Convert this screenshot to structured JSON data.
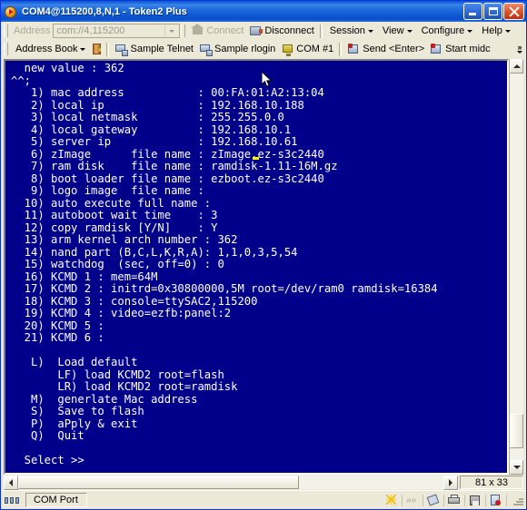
{
  "window": {
    "title": "COM4@115200,8,N,1 - Token2 Plus",
    "icon": "app-globe-icon",
    "buttons": {
      "minimize": "Minimize",
      "maximize": "Maximize",
      "close": "Close"
    }
  },
  "toolbar_top": {
    "address_label": "Address",
    "address_value": "com://4,115200",
    "connect_label": "Connect",
    "disconnect_label": "Disconnect",
    "menus": [
      "Session",
      "View",
      "Configure",
      "Help"
    ]
  },
  "toolbar_bottom": {
    "address_book_label": "Address Book",
    "items": [
      "Sample Telnet",
      "Sample rlogin",
      "COM #1",
      "Send <Enter>",
      "Start midc"
    ],
    "overflow": "»"
  },
  "terminal": {
    "background": "#00008b",
    "foreground": "#ffffff",
    "cursor_color": "#ffff00",
    "lines": [
      "  new value : 362",
      "^^;",
      "   1) mac address           : 00:FA:01:A2:13:04",
      "   2) local ip              : 192.168.10.188",
      "   3) local netmask         : 255.255.0.0",
      "   4) local gateway         : 192.168.10.1",
      "   5) server ip             : 192.168.10.61",
      "   6) zImage      file name : zImage.ez-s3c2440",
      "   7) ram disk    file name : ramdisk-1.11-16M.gz",
      "   8) boot loader file name : ezboot.ez-s3c2440",
      "   9) logo image  file name :",
      "  10) auto execute full name :",
      "  11) autoboot wait time    : 3",
      "  12) copy ramdisk [Y/N]    : Y",
      "  13) arm kernel arch number : 362",
      "  14) nand part (B,C,L,K,R,A): 1,1,0,3,5,54",
      "  15) watchdog  (sec, off=0) : 0",
      "  16) KCMD 1 : mem=64M",
      "  17) KCMD 2 : initrd=0x30800000,5M root=/dev/ram0 ramdisk=16384",
      "  18) KCMD 3 : console=ttySAC2,115200",
      "  19) KCMD 4 : video=ezfb:panel:2",
      "  20) KCMD 5 :",
      "  21) KCMD 6 :",
      "",
      "   L)  Load default",
      "       LF) load KCMD2 root=flash",
      "       LR) load KCMD2 root=ramdisk",
      "   M)  generlate Mac address",
      "   S)  Save to flash",
      "   P)  aPply & exit",
      "   Q)  Quit",
      "",
      "  Select >>"
    ]
  },
  "scrollbars": {
    "vertical_thumb_top_pct": 88,
    "vertical_thumb_height_pct": 9,
    "horizontal_thumb_width_pct": 66
  },
  "size_indicator": "81 x 33",
  "statusbar": {
    "connection_icon": "serial-connection-icon",
    "port_label": "COM Port",
    "icons": [
      "highlight-icon",
      "fast-forward-icon",
      "hand-pointer-icon",
      "printer-icon",
      "save-icon",
      "log-icon"
    ]
  }
}
